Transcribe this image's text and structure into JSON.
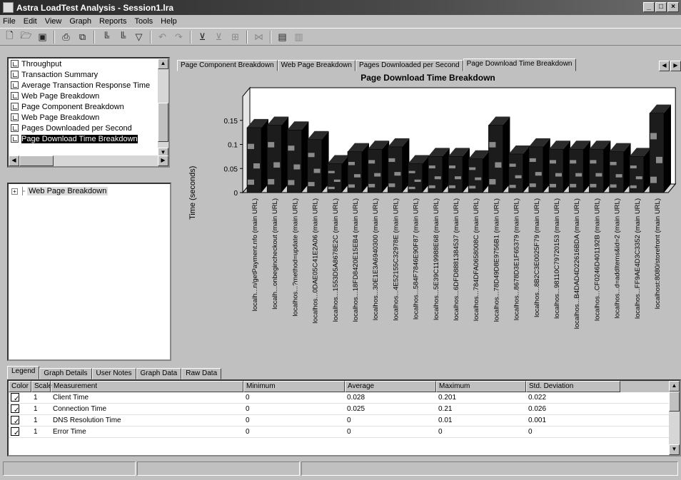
{
  "window": {
    "title": "Astra LoadTest Analysis - Session1.lra"
  },
  "menu": [
    "File",
    "Edit",
    "View",
    "Graph",
    "Reports",
    "Tools",
    "Help"
  ],
  "toolbar_icons": [
    "new-icon",
    "open-icon",
    "save-icon",
    "print-icon",
    "print-preview-icon",
    "add-graph-icon",
    "merge-graph-icon",
    "filter-icon",
    "undo-icon",
    "redo-icon",
    "filter-graph-icon",
    "clear-filter-icon",
    "granularity-icon",
    "cross-result-icon",
    "report-icon",
    "html-report-icon"
  ],
  "graph_list": [
    "Throughput",
    "Transaction Summary",
    "Average Transaction Response Time",
    "Web Page Breakdown",
    "Page Component Breakdown",
    "Web Page Breakdown",
    "Pages Downloaded per Second",
    "Page Download Time Breakdown"
  ],
  "tree": {
    "root": "Web Page Breakdown"
  },
  "chart_tabs": [
    "Page Component Breakdown",
    "Web Page Breakdown",
    "Pages Downloaded per Second",
    "Page Download Time Breakdown"
  ],
  "chart_data": {
    "type": "bar",
    "title": "Page Download Time Breakdown",
    "xlabel": "",
    "ylabel": "Time (seconds)",
    "ylim": [
      0,
      0.2
    ],
    "yticks": [
      "0",
      "0.05",
      "0.1",
      "0.15"
    ],
    "categories": [
      "localh...n/getPayment.nfo (main URL)",
      "localh...onbegincheckout (main URL)",
      "localhos...?method=update (main URL)",
      "localhos...0DAE05C41E2A06 (main URL)",
      "localhos...1553D5A8678E2C (main URL)",
      "localhos...18FD8420E15EB4 (main URL)",
      "localhos...30E1E3A6940300 (main URL)",
      "localhos...4E52155C32978E (main URL)",
      "localhos...584F7846E90F87 (main URL)",
      "localhos...5E39C119988E68 (main URL)",
      "localhos...6DFD8881384537 (main URL)",
      "localhos...784DFA0658008C (main URL)",
      "localhos...78D49D8E9756B1 (main URL)",
      "localhos...8678D3E1F65379 (main URL)",
      "localhos...8B2C3E0025F79 (main URL)",
      "localhos...98110C79720153 (main URL)",
      "localhos...B4DAD4D22616BDA (main URL)",
      "localhos...CF0246D401192B (main URL)",
      "localhos...d=addItems&id=2 (main URL)",
      "localhos...FF9AE4D3C3352 (main URL)",
      "localhost:8080/storefront (main URL)"
    ],
    "values": [
      0.135,
      0.14,
      0.13,
      0.11,
      0.06,
      0.085,
      0.09,
      0.095,
      0.06,
      0.075,
      0.075,
      0.07,
      0.14,
      0.08,
      0.095,
      0.09,
      0.09,
      0.09,
      0.085,
      0.075,
      0.165
    ],
    "colors": {
      "dark": "#1c1c1c",
      "light": "#8a8a8a",
      "floor": "#d4d4d4"
    }
  },
  "bottom_tabs": [
    "Legend",
    "Graph Details",
    "User Notes",
    "Graph Data",
    "Raw Data"
  ],
  "legend": {
    "headers": [
      "Color",
      "Scale",
      "Measurement",
      "Minimum",
      "Average",
      "Maximum",
      "Std. Deviation"
    ],
    "rows": [
      {
        "scale": "1",
        "measurement": "Client Time",
        "min": "0",
        "avg": "0.028",
        "max": "0.201",
        "std": "0.022"
      },
      {
        "scale": "1",
        "measurement": "Connection Time",
        "min": "0",
        "avg": "0.025",
        "max": "0.21",
        "std": "0.026"
      },
      {
        "scale": "1",
        "measurement": "DNS Resolution Time",
        "min": "0",
        "avg": "0",
        "max": "0.01",
        "std": "0.001"
      },
      {
        "scale": "1",
        "measurement": "Error Time",
        "min": "0",
        "avg": "0",
        "max": "0",
        "std": "0"
      }
    ]
  }
}
